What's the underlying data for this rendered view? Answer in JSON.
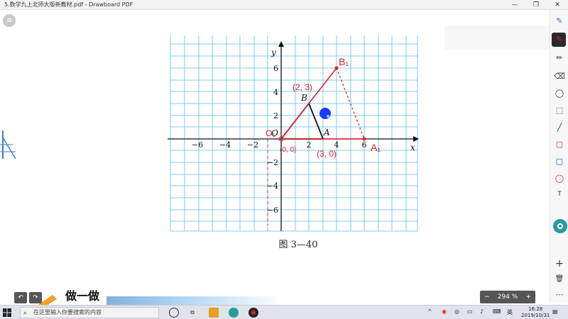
{
  "window": {
    "title": "5.数学九上北师大版新教材.pdf - Drawboard PDF",
    "controls": [
      "—",
      "❐",
      "✕"
    ]
  },
  "figure": {
    "caption": "图 3—40",
    "axis_x_label": "x",
    "axis_y_label": "y",
    "origin_label": "O",
    "x_ticks": [
      "−6",
      "−4",
      "−2",
      "2",
      "4",
      "6"
    ],
    "y_ticks": [
      "6",
      "4",
      "2",
      "−2",
      "−4",
      "−6"
    ],
    "point_A": "A",
    "point_B": "B",
    "handwritten_B": "(2, 3)",
    "handwritten_A": "(3, 0)",
    "handwritten_O": "(0, 0)",
    "label_B1": "B₁",
    "label_A1": "A₁",
    "label_O1": "O₁"
  },
  "page": {
    "section_title": "做一做"
  },
  "toolbar": {
    "undo": "↶",
    "redo": "↷",
    "zoom_minus": "−",
    "zoom_value": "294 %",
    "zoom_plus": "+"
  },
  "right_tools": {
    "add": "+",
    "delete": "🗑",
    "more": "⋯"
  },
  "taskbar": {
    "search_placeholder": "在这里输入你要搜索的内容",
    "language": "英",
    "time": "16:28",
    "date": "2019/10/31"
  },
  "colors": {
    "accent_red": "#e0202e",
    "grid_blue": "#4fb7e6",
    "pen_blue": "#1a3cff"
  }
}
